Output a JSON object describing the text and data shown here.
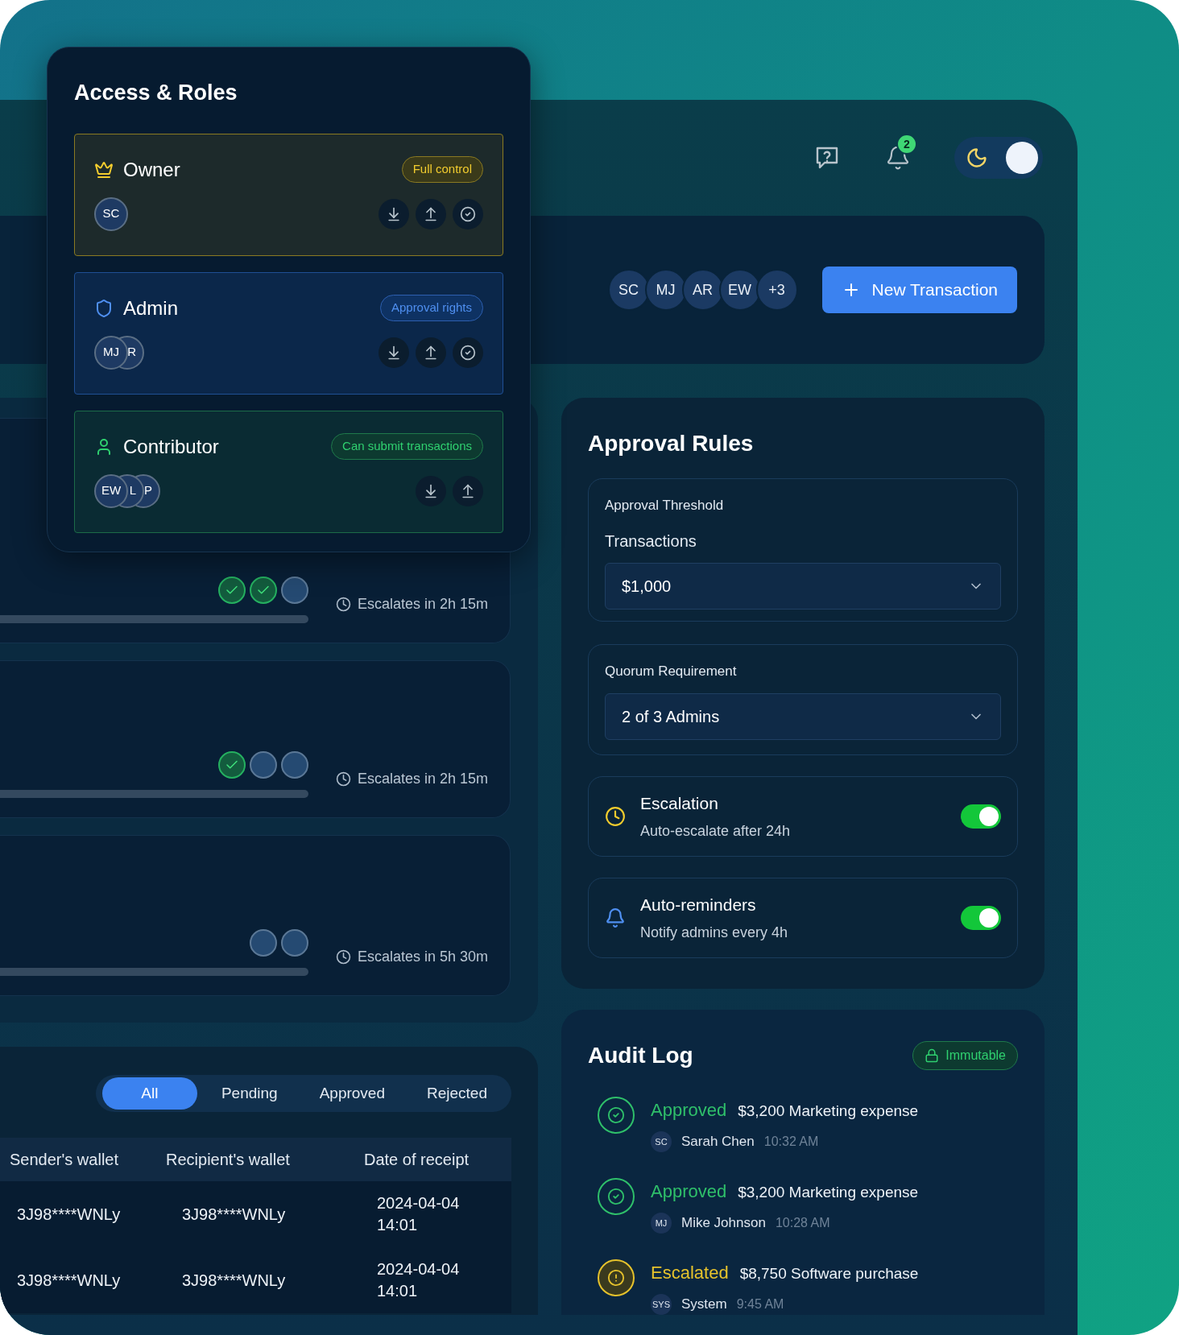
{
  "topbar": {
    "notifications": "2",
    "dark_mode": true
  },
  "header": {
    "avatars": [
      "SC",
      "MJ",
      "AR",
      "EW",
      "+3"
    ],
    "button": "New Transaction"
  },
  "requests": [
    {
      "approvers": [
        {
          "approved": true
        },
        {
          "approved": true
        },
        {
          "approved": false
        }
      ],
      "escalation": "Escalates in 2h 15m"
    },
    {
      "approvers": [
        {
          "approved": true
        },
        {
          "approved": false
        },
        {
          "approved": false
        }
      ],
      "escalation": "Escalates in 2h 15m"
    },
    {
      "approvers": [
        {
          "approved": false
        },
        {
          "approved": false
        }
      ],
      "escalation": "Escalates in 5h 30m"
    }
  ],
  "transactions": {
    "tabs": [
      {
        "label": "All",
        "selected": true
      },
      {
        "label": "Pending",
        "selected": false
      },
      {
        "label": "Approved",
        "selected": false
      },
      {
        "label": "Rejected",
        "selected": false
      }
    ],
    "columns": [
      "Sender's wallet",
      "Recipient's wallet",
      "Date of receipt"
    ],
    "rows": [
      [
        "3J98****WNLy",
        "3J98****WNLy",
        "2024-04-04 14:01"
      ],
      [
        "3J98****WNLy",
        "3J98****WNLy",
        "2024-04-04 14:01"
      ]
    ]
  },
  "approval_rules": {
    "title": "Approval Rules",
    "threshold": {
      "label": "Approval Threshold",
      "sublabel": "Transactions",
      "value": "$1,000"
    },
    "quorum": {
      "label": "Quorum Requirement",
      "value": "2 of 3 Admins"
    },
    "toggles": [
      {
        "kind": "escalation",
        "title": "Escalation",
        "subtitle": "Auto-escalate after 24h",
        "on": true
      },
      {
        "kind": "reminders",
        "title": "Auto-reminders",
        "subtitle": "Notify admins every 4h",
        "on": true
      }
    ]
  },
  "audit_log": {
    "title": "Audit Log",
    "badge": "Immutable",
    "entries": [
      {
        "kind": "approved",
        "status": "Approved",
        "description": "$3,200 Marketing expense",
        "initials": "SC",
        "name": "Sarah Chen",
        "time": "10:32 AM"
      },
      {
        "kind": "approved",
        "status": "Approved",
        "description": "$3,200 Marketing expense",
        "initials": "MJ",
        "name": "Mike Johnson",
        "time": "10:28 AM"
      },
      {
        "kind": "escalated",
        "status": "Escalated",
        "description": "$8,750 Software purchase",
        "initials": "SYS",
        "name": "System",
        "time": "9:45 AM"
      }
    ]
  },
  "access_roles": {
    "title": "Access & Roles",
    "roles": [
      {
        "kind": "owner",
        "name": "Owner",
        "badge": "Full control",
        "members": [
          "SC"
        ],
        "can_approve": true
      },
      {
        "kind": "admin",
        "name": "Admin",
        "badge": "Approval rights",
        "members": [
          "MJ",
          "R"
        ],
        "can_approve": true
      },
      {
        "kind": "contributor",
        "name": "Contributor",
        "badge": "Can submit transactions",
        "members": [
          "EW",
          "L",
          "P"
        ],
        "can_approve": false
      }
    ]
  }
}
